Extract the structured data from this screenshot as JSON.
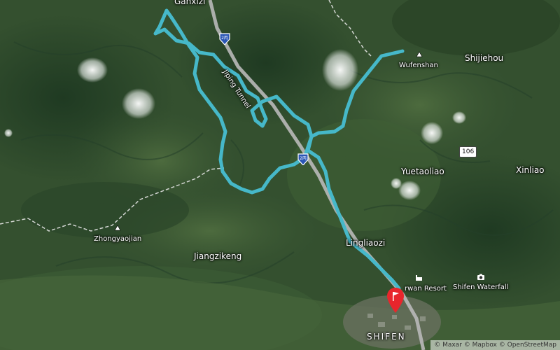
{
  "map": {
    "route_color": "#46b8c9",
    "highway_color": "#b9b9b9",
    "trail_color": "#e6e6e6",
    "pin_color": "#e8262c"
  },
  "labels": {
    "ganxizi": "Ganxizi",
    "jiping_tunnel": "Jiping Tunnel",
    "wufenshan": "Wufenshan",
    "shijiehou": "Shijiehou",
    "yuetaoliao": "Yuetaoliao",
    "xinliao": "Xinliao",
    "zhongyaojian": "Zhongyaojian",
    "jiangzikeng": "Jiangzikeng",
    "lingliaozi": "Lingliaozi",
    "resort": "rwan Resort",
    "shifen_waterfall": "Shifen Waterfall",
    "shifen": "SHIFEN"
  },
  "shields": {
    "freeway_top": "2丙",
    "freeway_mid": "2丙",
    "route_106": "106"
  },
  "attribution": "© Maxar © Mapbox © OpenStreetMap",
  "icons": {
    "peak": "peak-icon",
    "camera": "camera-icon",
    "hotel": "hotel-icon",
    "flag": "flag-pin-icon"
  }
}
